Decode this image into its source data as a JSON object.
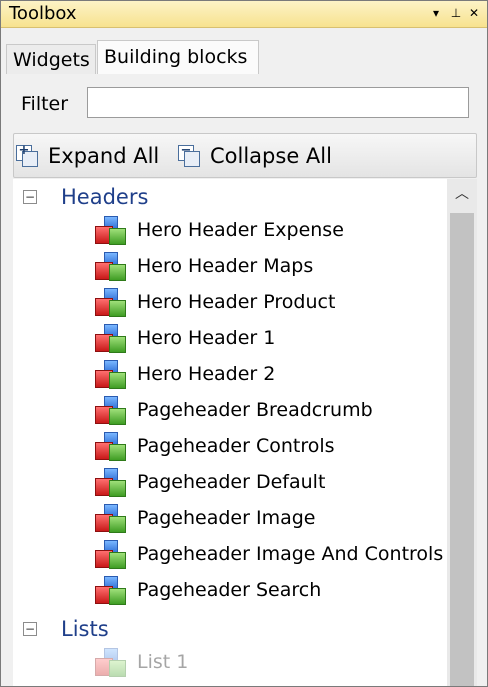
{
  "window": {
    "title": "Toolbox",
    "buttons": {
      "dropdown": "▾",
      "pin": "⊥",
      "close": "✕"
    }
  },
  "tabs": [
    {
      "label": "Widgets",
      "active": false
    },
    {
      "label": "Building blocks",
      "active": true
    }
  ],
  "filter": {
    "label": "Filter",
    "value": "",
    "placeholder": ""
  },
  "toolbar": {
    "expand_all": "Expand All",
    "collapse_all": "Collapse All"
  },
  "tree": {
    "groups": [
      {
        "label": "Headers",
        "expanded": true,
        "items": [
          "Hero Header Expense",
          "Hero Header Maps",
          "Hero Header Product",
          "Hero Header 1",
          "Hero Header 2",
          "Pageheader Breadcrumb",
          "Pageheader Controls",
          "Pageheader Default",
          "Pageheader Image",
          "Pageheader Image And Controls",
          "Pageheader Search"
        ]
      },
      {
        "label": "Lists",
        "expanded": true,
        "items": [
          "List 1"
        ]
      }
    ]
  },
  "icons": {
    "expand_all": "expand-all-icon",
    "collapse_all": "collapse-all-icon",
    "building_block": "building-block-icon",
    "group_expander": "collapse-minus-icon",
    "scroll_up": "chevron-up-icon"
  },
  "colors": {
    "title_bar": "#f7e28f",
    "group_label": "#1f3f8a",
    "block_red": "#c81919",
    "block_blue": "#2f6fd6",
    "block_green": "#3f9d24"
  }
}
